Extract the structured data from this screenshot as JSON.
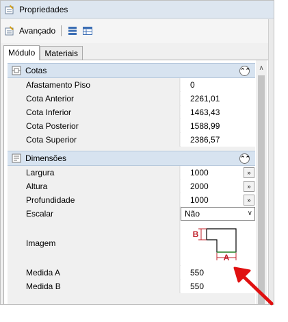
{
  "window": {
    "title": "Propriedades"
  },
  "toolbar": {
    "advanced_label": "Avançado"
  },
  "tabs": [
    {
      "label": "Módulo",
      "active": true
    },
    {
      "label": "Materiais",
      "active": false
    }
  ],
  "cotas": {
    "label": "Cotas",
    "rows": [
      {
        "name": "Afastamento Piso",
        "value": "0"
      },
      {
        "name": "Cota Anterior",
        "value": "2261,01"
      },
      {
        "name": "Cota Inferior",
        "value": "1463,43"
      },
      {
        "name": "Cota Posterior",
        "value": "1588,99"
      },
      {
        "name": "Cota Superior",
        "value": "2386,57"
      }
    ]
  },
  "dimensoes": {
    "label": "Dimensões",
    "largura": {
      "name": "Largura",
      "value": "1000"
    },
    "altura": {
      "name": "Altura",
      "value": "2000"
    },
    "profundidade": {
      "name": "Profundidade",
      "value": "1000"
    },
    "escalar": {
      "name": "Escalar",
      "value": "Não"
    },
    "imagem": {
      "name": "Imagem",
      "label_b": "B",
      "label_a": "A"
    },
    "medida_a": {
      "name": "Medida A",
      "value": "550"
    },
    "medida_b": {
      "name": "Medida B",
      "value": "550"
    }
  },
  "glyphs": {
    "collapse": "⌃⌃",
    "expand_dots": "»",
    "dropdown": "∨",
    "scroll_up": "∧"
  },
  "colors": {
    "category_bg": "#d7e3f0",
    "annotation_red": "#c0202a",
    "arrow_red": "#e01010"
  }
}
